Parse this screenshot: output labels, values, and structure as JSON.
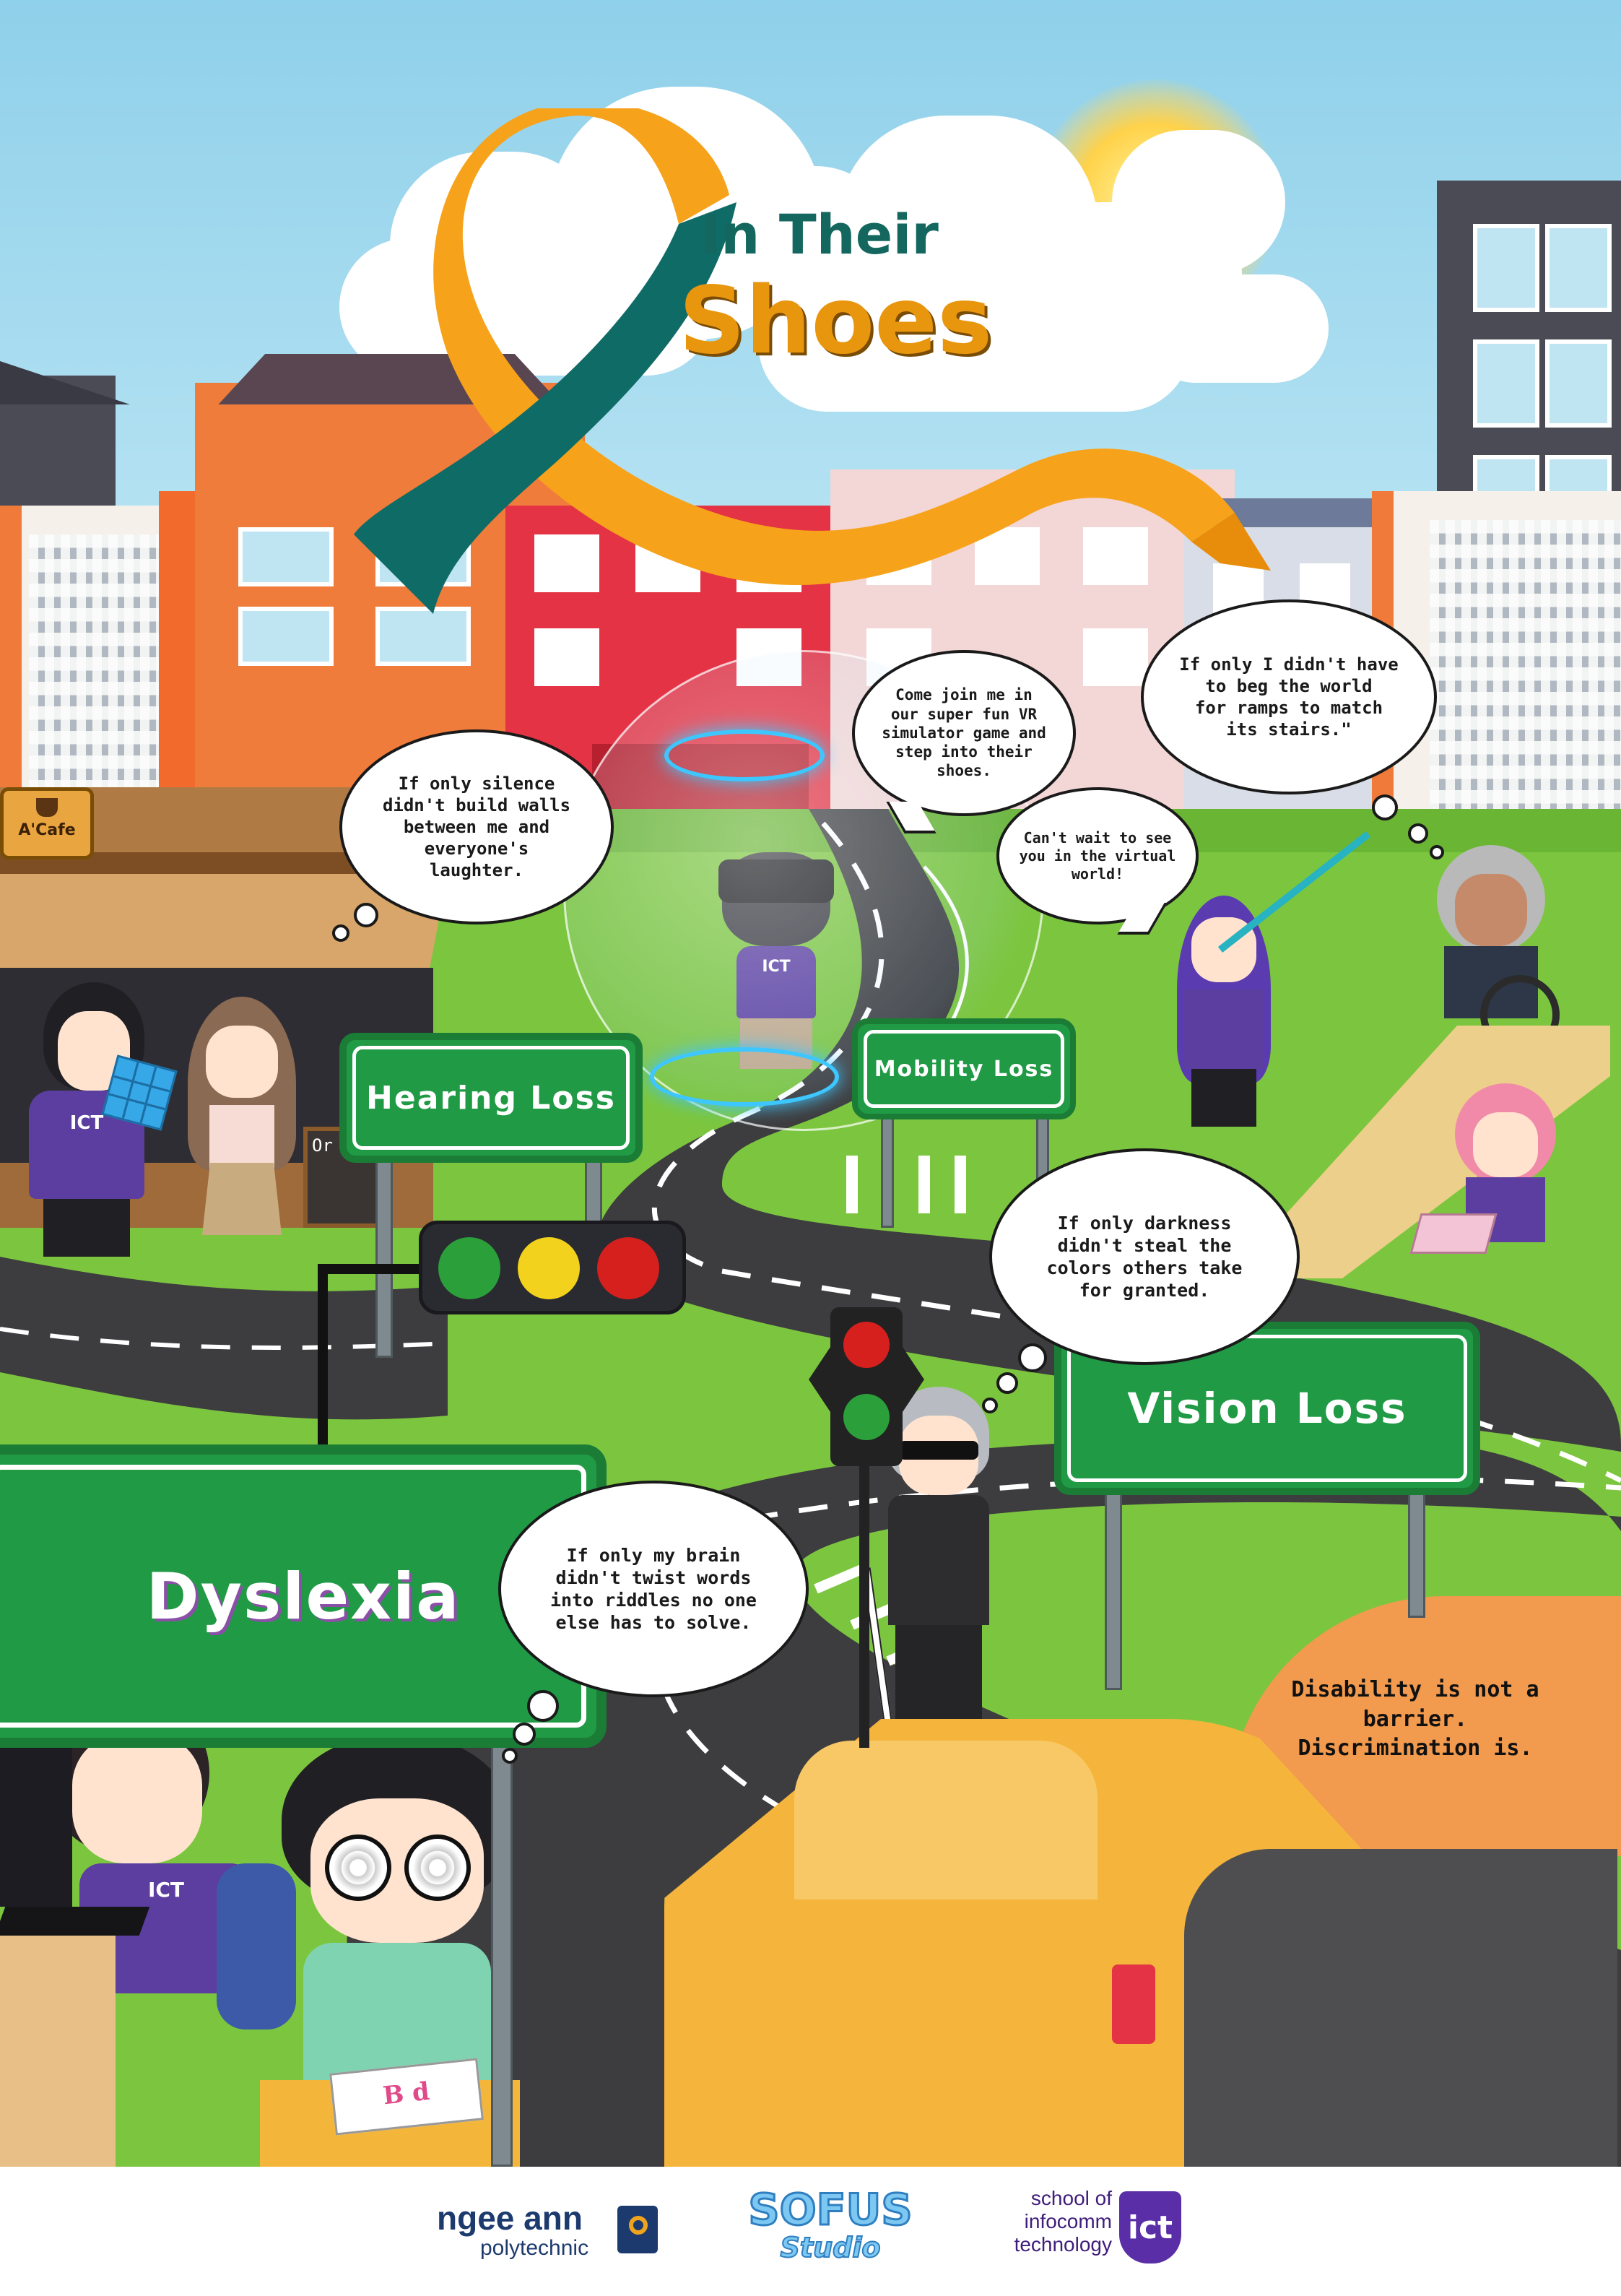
{
  "title": {
    "line1": "In Their",
    "line2": "Shoes"
  },
  "colors": {
    "ribbon_orange": "#f7a21b",
    "ribbon_teal": "#0f6b66",
    "sign_green": "#219a46",
    "title_teal": "#14675e",
    "title_orange": "#e9960f",
    "road": "#3d3d3f",
    "grass": "#7cc63f",
    "car_yellow": "#f5b53c",
    "awning_orange": "#f29a4e",
    "purple_shirt": "#5b3ea0"
  },
  "cafe": {
    "sign_text": "A'Cafe",
    "menu_board_text": "Or"
  },
  "signs": {
    "hearing": "Hearing Loss",
    "mobility": "Mobility Loss",
    "vision": "Vision Loss",
    "dyslexia": "Dyslexia"
  },
  "bubbles": {
    "hearing": "If only silence\ndidn't build walls\nbetween me and\neveryone's\nlaughter.",
    "vr_invite": "Come join me in\nour super fun VR\nsimulator game and\nstep into their\nshoes.",
    "virtual_world": "Can't wait to see\nyou in the virtual\nworld!",
    "mobility": "If only I didn't have\nto beg the world\nfor ramps to match\nits stairs.\"",
    "vision": "If only darkness\ndidn't steal the\ncolors others take\nfor granted.",
    "dyslexia": "If only my brain\ndidn't twist words\ninto riddles no one\nelse has to solve."
  },
  "shirt_text": "ICT",
  "slogan": {
    "line1": "Disability is not a barrier.",
    "line2": "Discrimination is."
  },
  "book_letters": "B d",
  "footer": {
    "ngee_ann_name": "ngee ann",
    "ngee_ann_sub": "polytechnic",
    "studio_line1": "SOFUS",
    "studio_line2": "Studio",
    "ict_line1": "school of",
    "ict_line2": "infocomm",
    "ict_line3": "technology",
    "ict_badge": "ict"
  },
  "icons": [
    "coffee-cup-icon",
    "traffic-light",
    "pedestrian-signal",
    "vr-headset",
    "wheelchair",
    "rubiks-cube",
    "white-cane",
    "laptop",
    "keyboard",
    "sun"
  ]
}
